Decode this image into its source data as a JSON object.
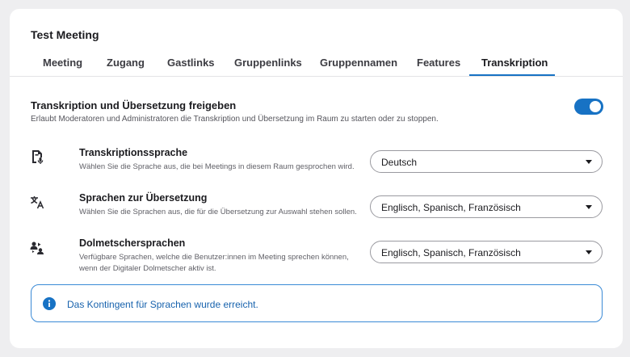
{
  "meeting": {
    "title": "Test Meeting"
  },
  "tabs": [
    {
      "label": "Meeting"
    },
    {
      "label": "Zugang"
    },
    {
      "label": "Gastlinks"
    },
    {
      "label": "Gruppenlinks"
    },
    {
      "label": "Gruppennamen"
    },
    {
      "label": "Features"
    },
    {
      "label": "Transkription",
      "active": true
    }
  ],
  "main_setting": {
    "title": "Transkription und Übersetzung freigeben",
    "description": "Erlaubt Moderatoren und Administratoren die Transkription und Übersetzung im Raum zu starten oder zu stoppen.",
    "enabled": true
  },
  "settings": [
    {
      "icon": "transcript-mic-icon",
      "title": "Transkriptionssprache",
      "description": "Wählen Sie die Sprache aus, die bei Meetings in diesem Raum gesprochen wird.",
      "value": "Deutsch"
    },
    {
      "icon": "translate-icon",
      "title": "Sprachen zur Übersetzung",
      "description": "Wählen Sie die Sprachen aus, die für die Übersetzung zur Auswahl stehen sollen.",
      "value": "Englisch, Spanisch, Französisch"
    },
    {
      "icon": "interpreter-icon",
      "title": "Dolmetschersprachen",
      "description": "Verfügbare Sprachen, welche die Benutzer:innen im Meeting sprechen können, wenn der Digitaler Dolmetscher aktiv ist.",
      "value": "Englisch, Spanisch, Französisch"
    }
  ],
  "notice": {
    "icon": "info-icon",
    "text": "Das Kontingent für Sprachen wurde erreicht."
  },
  "colors": {
    "accent": "#1772c4",
    "notice_text": "#1762ad"
  }
}
